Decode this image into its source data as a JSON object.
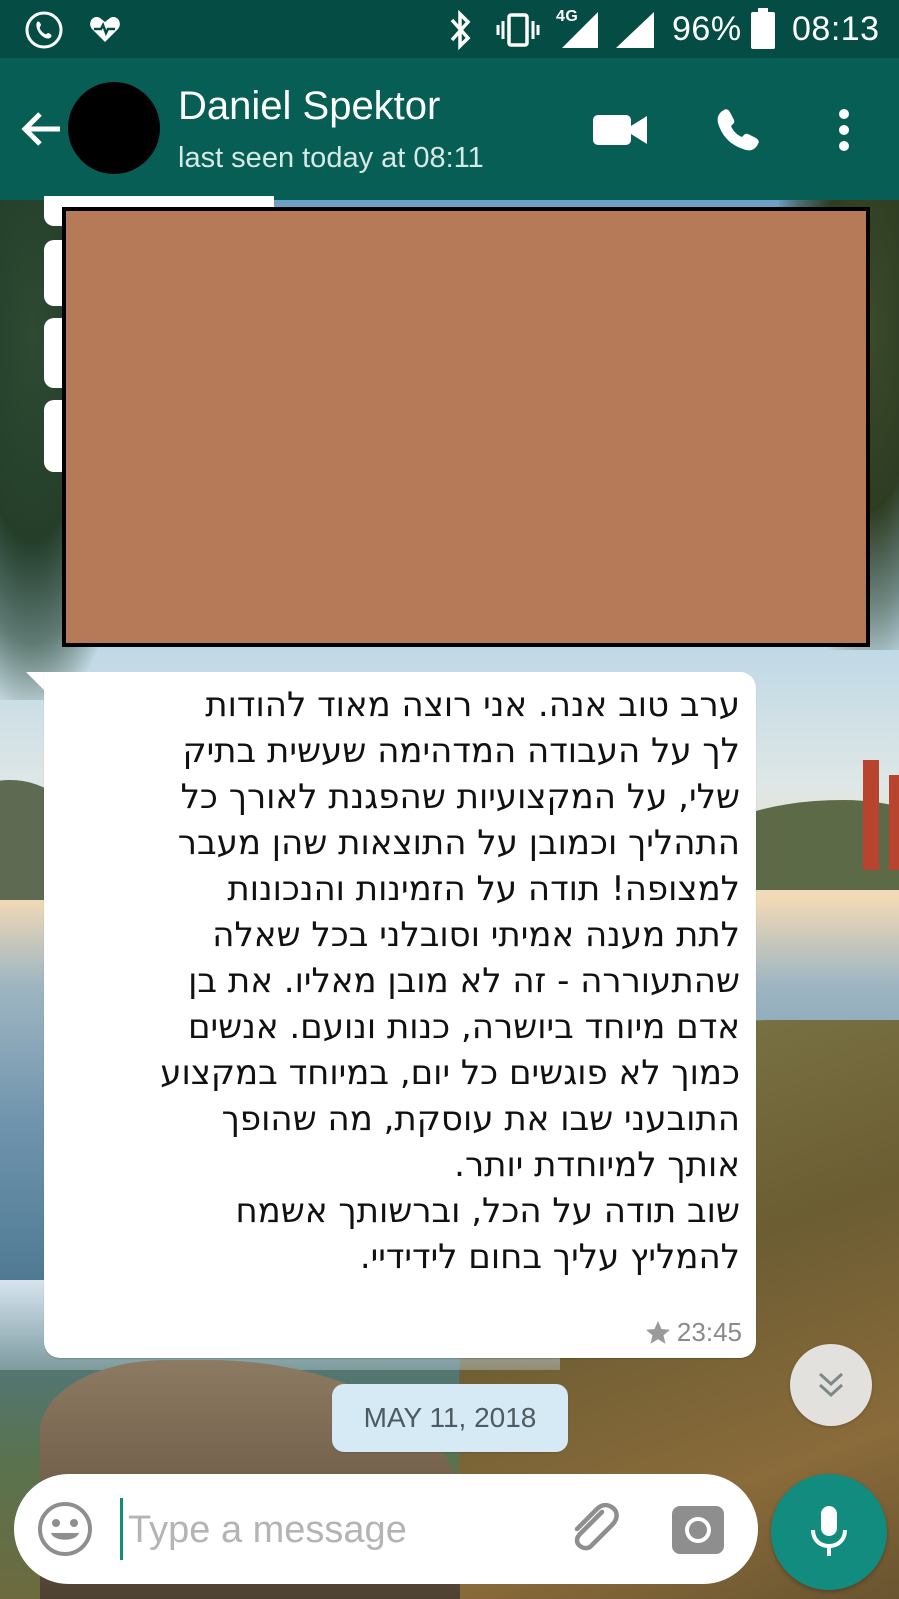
{
  "status_bar": {
    "battery": "96%",
    "time": "08:13",
    "network": "4G",
    "icons": [
      "whatsapp-icon",
      "health-icon",
      "bluetooth-icon",
      "vibrate-icon",
      "signal-4g-icon",
      "signal-icon",
      "battery-icon"
    ]
  },
  "header": {
    "contact_name": "Daniel Spektor",
    "contact_status": "last seen today at 08:11",
    "colors": {
      "bar": "#075e54",
      "status_bar": "#054d44"
    }
  },
  "message": {
    "text": "ערב טוב אנה. אני רוצה מאוד להודות\nלך על העבודה המדהימה שעשית בתיק\nשלי, על המקצועיות שהפגנת לאורך כל\nהתהליך וכמובן על התוצאות שהן מעבר\nלמצופה! תודה על הזמינות והנכונות\nלתת מענה אמיתי וסובלני בכל שאלה\nשהתעוררה - זה לא מובן מאליו. את בן\nאדם מיוחד ביושרה, כנות ונועם. אנשים\nכמוך לא פוגשים כל יום, במיוחד במקצוע\nהתובעני שבו את עוסקת, מה שהופך\nאותך למיוחדת יותר.\nשוב תודה על הכל, וברשותך אשמח\nלהמליץ עליך בחום לידידיי.",
    "time": "23:45",
    "starred": true
  },
  "date_chip": "MAY 11, 2018",
  "input": {
    "placeholder": "Type a message",
    "value": ""
  },
  "accent_color": "#128c7e"
}
